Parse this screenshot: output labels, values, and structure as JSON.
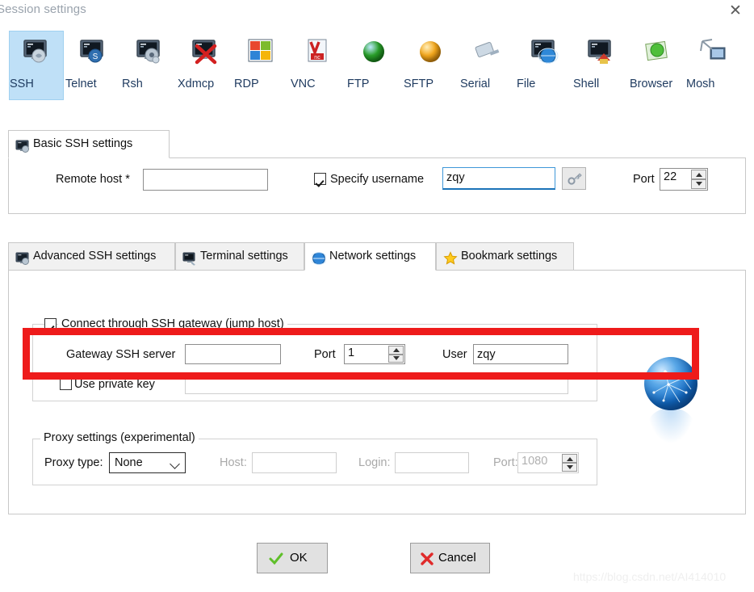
{
  "window": {
    "title": "Session settings",
    "close_label": "✕"
  },
  "session_types": [
    {
      "label": "SSH",
      "icon": "ssh-icon",
      "selected": true
    },
    {
      "label": "Telnet",
      "icon": "telnet-icon",
      "selected": false
    },
    {
      "label": "Rsh",
      "icon": "rsh-icon",
      "selected": false
    },
    {
      "label": "Xdmcp",
      "icon": "xdmcp-icon",
      "selected": false
    },
    {
      "label": "RDP",
      "icon": "rdp-icon",
      "selected": false
    },
    {
      "label": "VNC",
      "icon": "vnc-icon",
      "selected": false
    },
    {
      "label": "FTP",
      "icon": "ftp-icon",
      "selected": false
    },
    {
      "label": "SFTP",
      "icon": "sftp-icon",
      "selected": false
    },
    {
      "label": "Serial",
      "icon": "serial-icon",
      "selected": false
    },
    {
      "label": "File",
      "icon": "file-icon",
      "selected": false
    },
    {
      "label": "Shell",
      "icon": "shell-icon",
      "selected": false
    },
    {
      "label": "Browser",
      "icon": "browser-icon",
      "selected": false
    },
    {
      "label": "Mosh",
      "icon": "mosh-icon",
      "selected": false
    }
  ],
  "basic": {
    "tab_label": "Basic SSH settings",
    "remote_host_label": "Remote host *",
    "remote_host_value": "",
    "specify_username_label": "Specify username",
    "specify_username_checked": true,
    "username_value": "zqy",
    "key_button_icon": "key-icon",
    "port_label": "Port",
    "port_value": "22"
  },
  "settings_tabs": [
    {
      "label": "Advanced SSH settings",
      "icon": "monitor-icon",
      "active": false
    },
    {
      "label": "Terminal settings",
      "icon": "terminal-icon",
      "active": false
    },
    {
      "label": "Network settings",
      "icon": "globe-icon",
      "active": true
    },
    {
      "label": "Bookmark settings",
      "icon": "star-icon",
      "active": false
    }
  ],
  "gateway": {
    "group_label": "Connect through SSH gateway (jump host)",
    "group_checked": true,
    "server_label": "Gateway SSH server",
    "server_value": "",
    "port_label": "Port",
    "port_value": "1",
    "user_label": "User",
    "user_value": "zqy",
    "private_key_label": "Use private key",
    "private_key_checked": false,
    "private_key_value": ""
  },
  "proxy": {
    "group_label": "Proxy settings (experimental)",
    "type_label": "Proxy type:",
    "type_value": "None",
    "type_options": [
      "None"
    ],
    "host_label": "Host:",
    "host_value": "",
    "login_label": "Login:",
    "login_value": "",
    "port_label": "Port:",
    "port_value": "1080"
  },
  "footer": {
    "ok_label": "OK",
    "cancel_label": "Cancel",
    "ok_icon": "check-icon",
    "cancel_icon": "cross-icon"
  },
  "watermark": "https://blog.csdn.net/AI414010",
  "colors": {
    "selection": "#bfe0f7",
    "annotation": "#ee1b1b",
    "focus": "#1b73b8"
  }
}
